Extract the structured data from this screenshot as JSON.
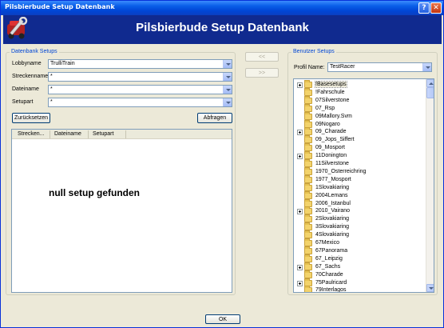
{
  "window": {
    "title": "Pilsbierbude Setup Datenbank",
    "help_glyph": "?",
    "close_glyph": "✕"
  },
  "banner": {
    "title": "Pilsbierbude Setup Datenbank",
    "logo_icon": "wrench-car-icon"
  },
  "datenbank": {
    "group_label": "Datenbank Setups",
    "fields": [
      {
        "label": "Lobbyname",
        "value": "TrulliTrain"
      },
      {
        "label": "Streckenname",
        "value": "*"
      },
      {
        "label": "Dateiname",
        "value": "*"
      },
      {
        "label": "Setupart",
        "value": "*"
      }
    ],
    "reset_label": "Zurücksetzen",
    "query_label": "Abfragen",
    "columns": [
      "Strecken...",
      "Dateiname",
      "Setupart"
    ],
    "empty_message": "null setup gefunden"
  },
  "transfer": {
    "left_label": "<<",
    "right_label": ">>"
  },
  "benutzer": {
    "group_label": "Benutzer Setups",
    "profile_label": "Profil Name:",
    "profile_value": "TestRacer",
    "tree": [
      {
        "label": "!Basesetups",
        "expandable": true,
        "selected": true
      },
      {
        "label": "!Fahrschule",
        "expandable": false
      },
      {
        "label": "07Silverstone",
        "expandable": false
      },
      {
        "label": "07_Rsp",
        "expandable": false
      },
      {
        "label": "09Mallory.Svm",
        "expandable": false
      },
      {
        "label": "09Nogaro",
        "expandable": false
      },
      {
        "label": "09_Charade",
        "expandable": true
      },
      {
        "label": "09_Jops_Siffert",
        "expandable": false
      },
      {
        "label": "09_Mosport",
        "expandable": false
      },
      {
        "label": "11Donington",
        "expandable": true
      },
      {
        "label": "11Silverstone",
        "expandable": false
      },
      {
        "label": "1970_Osterreichring",
        "expandable": false
      },
      {
        "label": "1977_Mosport",
        "expandable": false
      },
      {
        "label": "1Slovakiaring",
        "expandable": false
      },
      {
        "label": "2004Lemans",
        "expandable": false
      },
      {
        "label": "2006_Istanbul",
        "expandable": false
      },
      {
        "label": "2010_Vairano",
        "expandable": true
      },
      {
        "label": "2Slovakiaring",
        "expandable": false
      },
      {
        "label": "3Slovakiaring",
        "expandable": false
      },
      {
        "label": "4Slovakiaring",
        "expandable": false
      },
      {
        "label": "67Mexico",
        "expandable": false
      },
      {
        "label": "67Panorama",
        "expandable": false
      },
      {
        "label": "67_Leipzig",
        "expandable": false
      },
      {
        "label": "67_Sachs",
        "expandable": true
      },
      {
        "label": "70Charade",
        "expandable": false
      },
      {
        "label": "75Paulricard",
        "expandable": true
      },
      {
        "label": "79Interlagos",
        "expandable": false
      }
    ]
  },
  "footer": {
    "ok_label": "OK"
  }
}
